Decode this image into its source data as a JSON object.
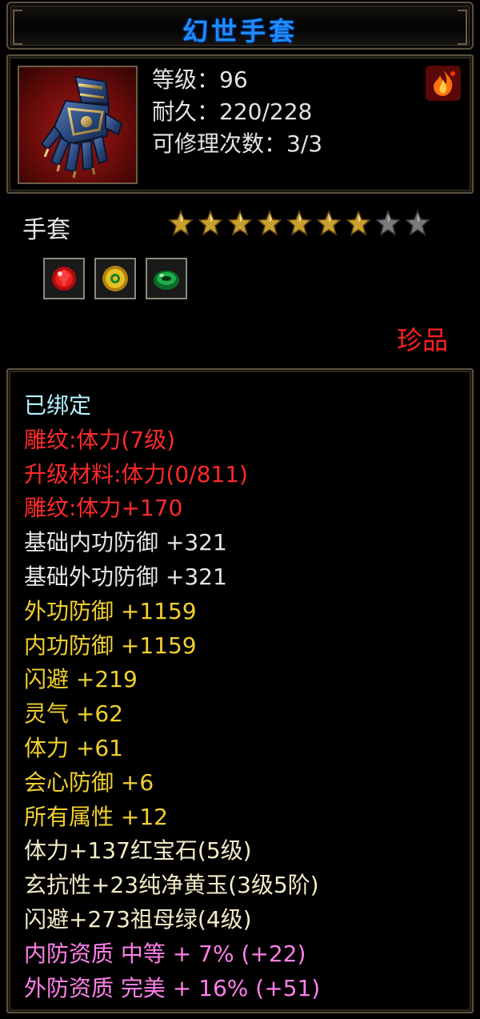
{
  "title": "幻世手套",
  "item": {
    "icon": "gauntlet-icon",
    "level_line": "等级：96",
    "durability_line": "耐久：220/228",
    "repair_line": "可修理次数：3/3",
    "badge_icon": "fire-emblem-icon"
  },
  "type_label": "手套",
  "stars": {
    "filled": 7,
    "total": 9
  },
  "gems": [
    {
      "name": "ruby-gem-icon",
      "color": "#e01818"
    },
    {
      "name": "yellow-jade-gem-icon",
      "color": "#e0b010"
    },
    {
      "name": "emerald-gem-icon",
      "color": "#1ea040"
    }
  ],
  "rarity": "珍品",
  "colors": {
    "title": "#1e8cff",
    "bound": "#b4f2ff",
    "engrave": "#ff2a2a",
    "base": "#e6e6e6",
    "bonus": "#f0d030",
    "gem": "#f2ecc8",
    "quality": "#ff80e8"
  },
  "attributes": [
    {
      "text": "已绑定",
      "style": "cyan"
    },
    {
      "text": "雕纹:体力(7级)",
      "style": "red"
    },
    {
      "text": "升级材料:体力(0/811)",
      "style": "red"
    },
    {
      "text": "雕纹:体力+170",
      "style": "red"
    },
    {
      "text": "基础内功防御 +321",
      "style": "white"
    },
    {
      "text": "基础外功防御 +321",
      "style": "white"
    },
    {
      "text": "外功防御 +1159",
      "style": "yellow"
    },
    {
      "text": "内功防御 +1159",
      "style": "yellow"
    },
    {
      "text": "闪避 +219",
      "style": "yellow"
    },
    {
      "text": "灵气 +62",
      "style": "yellow"
    },
    {
      "text": "体力 +61",
      "style": "yellow"
    },
    {
      "text": "会心防御 +6",
      "style": "yellow"
    },
    {
      "text": "所有属性 +12",
      "style": "yellow"
    },
    {
      "text": "体力+137红宝石(5级)",
      "style": "cream"
    },
    {
      "text": "玄抗性+23纯净黄玉(3级5阶)",
      "style": "cream"
    },
    {
      "text": "闪避+273祖母绿(4级)",
      "style": "cream"
    },
    {
      "text": "内防资质 中等 + 7% (+22)",
      "style": "pink"
    },
    {
      "text": "外防资质 完美 + 16% (+51)",
      "style": "pink"
    }
  ]
}
